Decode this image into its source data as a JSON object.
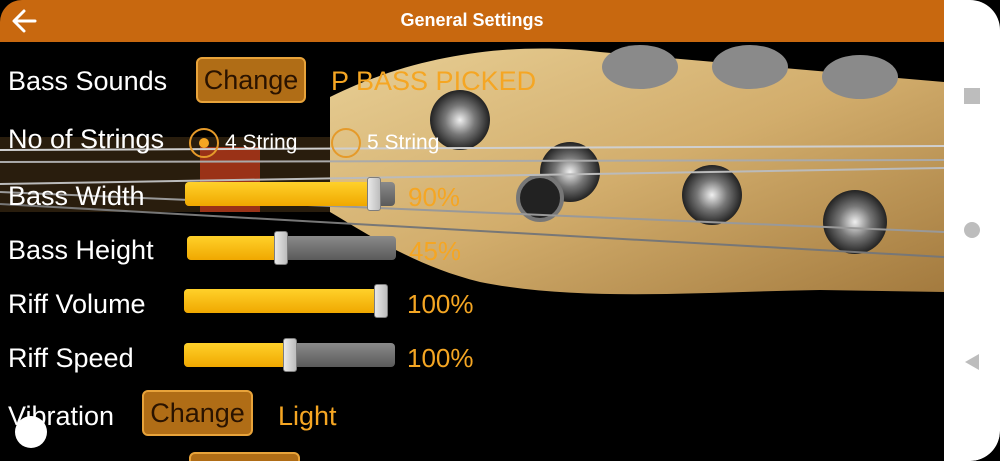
{
  "header": {
    "title": "General Settings",
    "back_icon": "arrow-left-icon",
    "color": "#c8680f"
  },
  "settings": {
    "bass_sounds": {
      "label": "Bass Sounds",
      "button": "Change",
      "value": "P BASS PICKED"
    },
    "strings": {
      "label": "No of Strings",
      "options": [
        "4 String",
        "5 String"
      ],
      "selected": "4 String"
    },
    "bass_width": {
      "label": "Bass Width",
      "value_text": "90%",
      "level": 0.9
    },
    "bass_height": {
      "label": "Bass Height",
      "value_text": "45%",
      "level": 0.45
    },
    "riff_volume": {
      "label": "Riff Volume",
      "value_text": "100%",
      "level": 1.0
    },
    "riff_speed": {
      "label": "Riff Speed",
      "value_text": "100%",
      "level": 0.5
    },
    "vibration": {
      "label": "Vibration",
      "button": "Change",
      "value": "Light"
    }
  },
  "navbar": {
    "icons": [
      "square-icon",
      "circle-icon",
      "triangle-left-icon"
    ]
  },
  "colors": {
    "accent": "#f5a623",
    "slider_fill": "#ffc20e"
  }
}
